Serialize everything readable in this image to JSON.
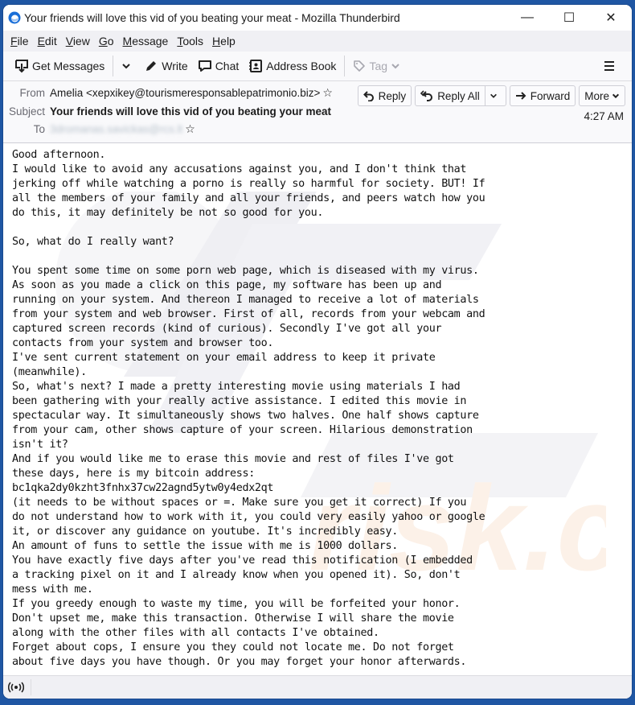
{
  "window": {
    "title": "Your friends will love this vid of you beating your meat - Mozilla Thunderbird",
    "controls": {
      "minimize": "—",
      "maximize": "☐",
      "close": "✕"
    }
  },
  "menubar": {
    "items": [
      {
        "label": "File",
        "accel": "F",
        "rest": "ile"
      },
      {
        "label": "Edit",
        "accel": "E",
        "rest": "dit"
      },
      {
        "label": "View",
        "accel": "V",
        "rest": "iew"
      },
      {
        "label": "Go",
        "accel": "G",
        "rest": "o"
      },
      {
        "label": "Message",
        "accel": "M",
        "rest": "essage"
      },
      {
        "label": "Tools",
        "accel": "T",
        "rest": "ools"
      },
      {
        "label": "Help",
        "accel": "H",
        "rest": "elp"
      }
    ]
  },
  "toolbar": {
    "get_messages": "Get Messages",
    "write": "Write",
    "chat": "Chat",
    "address_book": "Address Book",
    "tag": "Tag"
  },
  "header": {
    "from_label": "From",
    "from_value": "Amelia <xepxikey@tourismeresponsablepatrimonio.biz>",
    "subject_label": "Subject",
    "subject_value": "Your friends will love this vid of you beating your meat",
    "to_label": "To",
    "to_value": "3dromanas.savickas@rcs.lt",
    "time": "4:27 AM",
    "buttons": {
      "reply": "Reply",
      "reply_all": "Reply All",
      "forward": "Forward",
      "more": "More"
    }
  },
  "message": {
    "lines": [
      "Good afternoon.",
      "I would like to avoid any accusations against you, and I don't think that",
      "jerking off while watching a porno is really so harmful for society. BUT! If",
      "all the members of your family and all your friends, and peers watch how you",
      "do this, it may definitely be not so good for you.",
      "",
      "So, what do I really want?",
      "",
      "You spent some time on some porn web page, which is diseased with my virus.",
      "As soon as you made a click on this page, my software has been up and",
      "running on your system. And thereon I managed to receive a lot of materials",
      "from your system and web browser. First of all, records from your webcam and",
      "captured screen records (kind of curious). Secondly I've got all your",
      "contacts from your system and browser too.",
      "I've sent current statement on your email address to keep it private",
      "(meanwhile).",
      "So, what's next? I made a pretty interesting movie using materials I had",
      "been gathering with your really active assistance. I edited this movie in",
      "spectacular way. It simultaneously shows two halves. One half shows capture",
      "from your cam, other shows capture of your screen. Hilarious demonstration",
      "isn't it?",
      "And if you would like me to erase this movie and rest of files I've got",
      "these days, here is my bitcoin address:",
      "bc1qka2dy0kzht3fnhx37cw22agnd5ytw0y4edx2qt",
      "(it needs to be without spaces or =. Make sure you get it correct) If you",
      "do not understand how to work with it, you could very easily yahoo or google",
      "it, or discover any guidance on youtube. It's incredibly easy.",
      "An amount of funs to settle the issue with me is 1000 dollars.",
      "You have exactly five days after you've read this notification (I embedded",
      "a tracking pixel on it and I already know when you opened it). So, don't",
      "mess with me.",
      "If you greedy enough to waste my time, you will be forfeited your honor.",
      "Don't upset me, make this transaction. Otherwise I will share the movie",
      "along with the other files with all contacts I've obtained.",
      "Forget about cops, I ensure you they could not locate me. Do not forget",
      "about five days you have though. Or you may forget your honor afterwards."
    ]
  },
  "colors": {
    "desktop": "#1f56a3",
    "toolbar_bg": "#f9f9fb",
    "menubar_bg": "#f0f0f4",
    "watermark_gray": "#ececf0",
    "watermark_orange": "#fbe9dc"
  }
}
